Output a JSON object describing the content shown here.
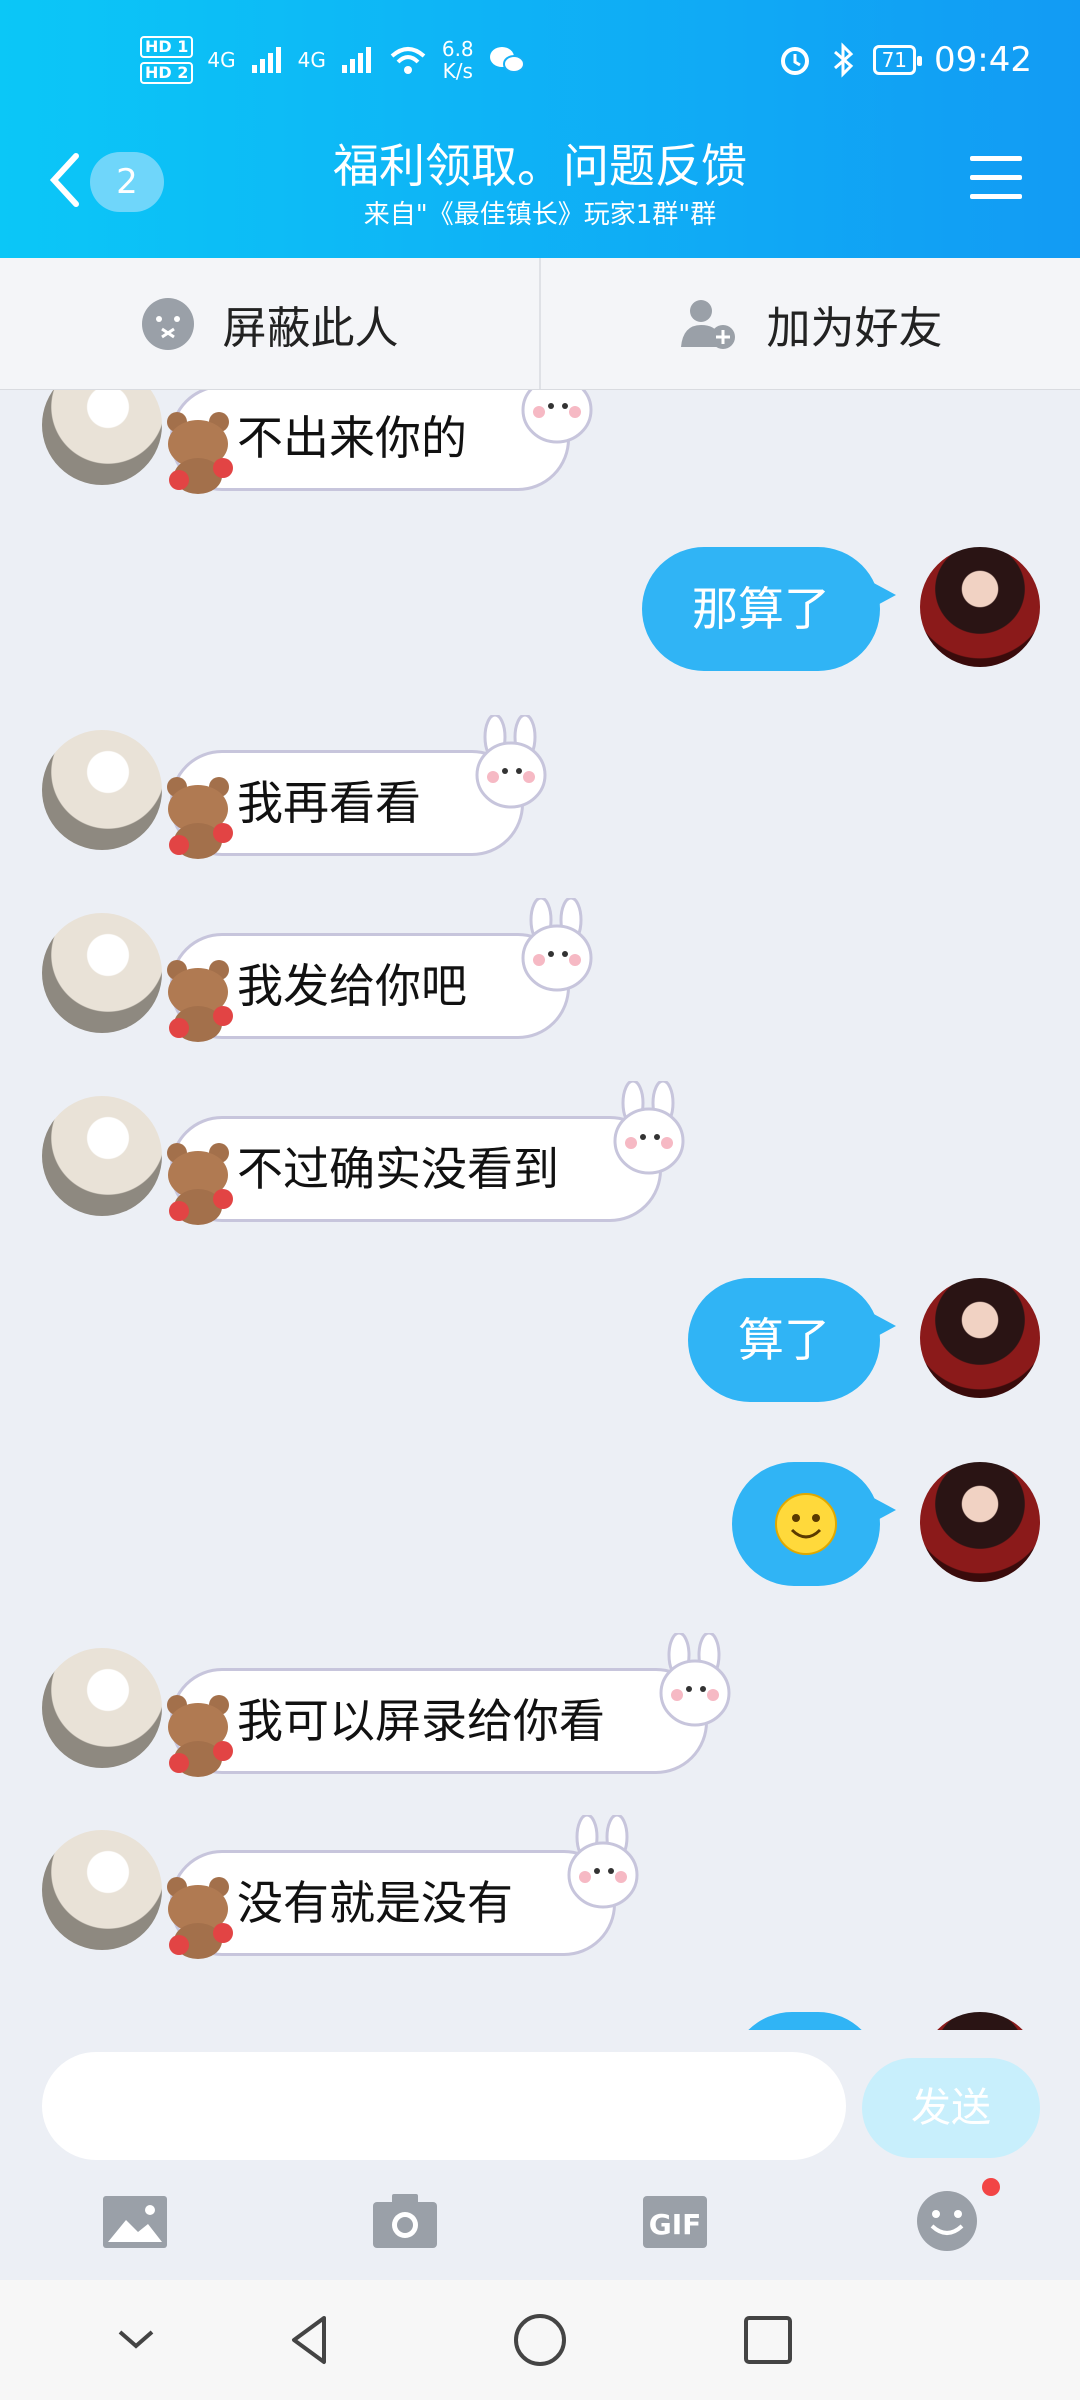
{
  "status_bar": {
    "hd1": "HD 1",
    "hd2": "HD 2",
    "net1": "4G",
    "net2": "4G",
    "speed_value": "6.8",
    "speed_unit": "K/s",
    "battery": "71",
    "time": "09:42"
  },
  "header": {
    "back_count": "2",
    "title": "福利领取。问题反馈",
    "subtitle": "来自\"《最佳镇长》玩家1群\"群"
  },
  "actions": {
    "block_label": "屏蔽此人",
    "add_friend_label": "加为好友"
  },
  "messages": [
    {
      "side": "left",
      "text": "不出来你的"
    },
    {
      "side": "right",
      "text": "那算了"
    },
    {
      "side": "left",
      "text": "我再看看"
    },
    {
      "side": "left",
      "text": "我发给你吧"
    },
    {
      "side": "left",
      "text": "不过确实没看到"
    },
    {
      "side": "right",
      "text": "算了"
    },
    {
      "side": "right",
      "text": "",
      "emoji": "smile-emoji"
    },
    {
      "side": "left",
      "text": "我可以屏录给你看"
    },
    {
      "side": "left",
      "text": "没有就是没有"
    }
  ],
  "input": {
    "placeholder": "",
    "send_label": "发送"
  },
  "toolbar": {
    "gif_label": "GIF"
  },
  "colors": {
    "header_start": "#0bc7f7",
    "header_end": "#129bf4",
    "bubble_self": "#30b4f5",
    "send_disabled": "#c8effc",
    "notify_dot": "#f24545"
  }
}
